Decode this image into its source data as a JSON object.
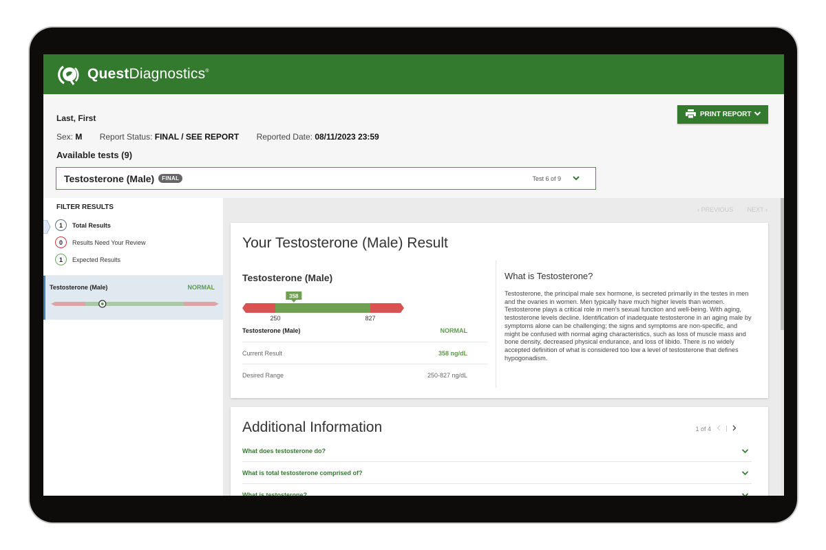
{
  "brand": {
    "name_bold": "Quest",
    "name_light": "Diagnostics",
    "trademark": "®",
    "color": "#337a2e"
  },
  "patient": {
    "name": "Last, First",
    "sex_label": "Sex:",
    "sex": "M",
    "status_label": "Report Status:",
    "status": "FINAL / SEE REPORT",
    "date_label": "Reported Date:",
    "date": "08/11/2023 23:59"
  },
  "tests": {
    "available_label": "Available tests (9)",
    "selected": "Testosterone (Male)",
    "selected_badge": "FINAL",
    "position": "Test 6 of 9"
  },
  "print_button": {
    "label": "PRINT REPORT",
    "icon": "printer-icon"
  },
  "filter": {
    "title": "FILTER RESULTS",
    "items": [
      {
        "count": "1",
        "label": "Total Results",
        "selected": true
      },
      {
        "count": "0",
        "label": "Results Need Your Review"
      },
      {
        "count": "1",
        "label": "Expected Results"
      }
    ]
  },
  "result_list": [
    {
      "name": "Testosterone (Male)",
      "status": "NORMAL",
      "value_fraction": 0.25
    }
  ],
  "pager": {
    "previous": "‹ PREVIOUS",
    "next": "NEXT ›"
  },
  "result_card": {
    "title": "Your Testosterone (Male) Result",
    "test_name": "Testosterone (Male)",
    "value": "358",
    "range_low": "250",
    "range_high": "827",
    "range_value": 358,
    "range_min": 250,
    "range_max": 827,
    "status_row_label": "Testosterone (Male)",
    "status": "NORMAL",
    "current_label": "Current Result",
    "current_value": "358 ng/dL",
    "desired_label": "Desired Range",
    "desired_value": "250-827 ng/dL",
    "colors": {
      "normal": "#6f9f50",
      "abnormal": "#d95353"
    }
  },
  "info": {
    "title": "What is Testosterone?",
    "body": "Testosterone, the principal male sex hormone, is secreted primarily in the testes in men and the ovaries in women. Men typically have much higher levels than women. Testosterone plays a critical role in men's sexual function and well-being. With aging, testosterone levels decline. Identification of inadequate testosterone in an aging male by symptoms alone can be challenging; the signs and symptoms are non-specific, and might be confused with normal aging characteristics, such as loss of muscle mass and bone density, decreased physical endurance, and loss of libido. There is no widely accepted definition of what is considered too low a level of testosterone that defines hypogonadism."
  },
  "additional": {
    "title": "Additional Information",
    "page": "1 of 4",
    "questions": [
      "What does testosterone do?",
      "What is total testosterone comprised of?",
      "What is testosterone?"
    ]
  }
}
